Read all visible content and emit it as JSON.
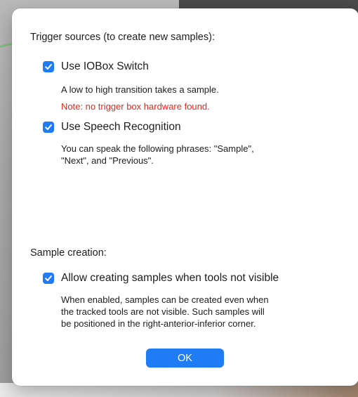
{
  "trigger_section": {
    "title": "Trigger sources (to create new samples):",
    "iobox": {
      "label": "Use IOBox Switch",
      "checked": true,
      "description": "A low to high transition takes a sample.",
      "warning": "Note: no trigger box hardware found."
    },
    "speech": {
      "label": "Use Speech Recognition",
      "checked": true,
      "description_line1": "You can speak the following phrases: \"Sample\",",
      "description_line2": "\"Next\", and \"Previous\"."
    }
  },
  "sample_section": {
    "title": "Sample creation:",
    "allow_invisible": {
      "label": "Allow creating samples when tools not visible",
      "checked": true,
      "description_line1": "When enabled, samples can be created even when",
      "description_line2": "the tracked tools are not visible. Such samples will",
      "description_line3": "be positioned in the right-anterior-inferior corner."
    }
  },
  "buttons": {
    "ok_label": "OK"
  },
  "colors": {
    "accent": "#1f7cf5",
    "warning": "#e8271b"
  }
}
